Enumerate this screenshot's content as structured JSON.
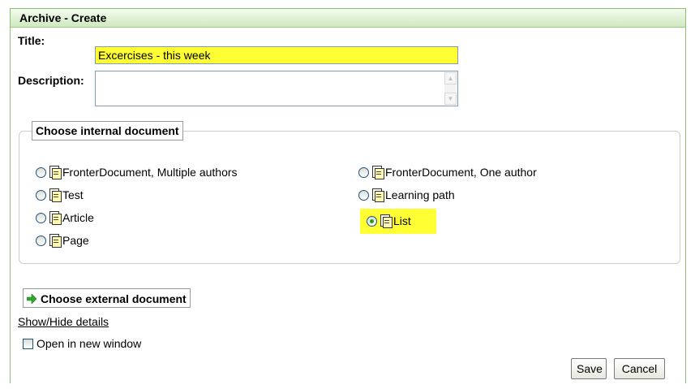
{
  "window": {
    "title": "Archive - Create"
  },
  "form": {
    "title_label": "Title:",
    "title_value": "Excercises - this week",
    "description_label": "Description:",
    "description_value": ""
  },
  "internal_group": {
    "legend": "Choose internal document",
    "options": [
      {
        "label": "FronterDocument, Multiple authors",
        "icon": "fronter-multi-icon",
        "selected": false
      },
      {
        "label": "Test",
        "icon": "test-icon",
        "selected": false
      },
      {
        "label": "Article",
        "icon": "article-icon",
        "selected": false
      },
      {
        "label": "Page",
        "icon": "page-icon",
        "selected": false
      },
      {
        "label": "FronterDocument, One author",
        "icon": "fronter-single-icon",
        "selected": false
      },
      {
        "label": "Learning path",
        "icon": "learning-path-icon",
        "selected": false
      },
      {
        "label": "List",
        "icon": "list-icon",
        "selected": true
      }
    ]
  },
  "external": {
    "label": "Choose external document",
    "icon": "green-arrow-icon"
  },
  "details_link": "Show/Hide details",
  "new_window": {
    "label": "Open in new window",
    "checked": false
  },
  "buttons": {
    "save": "Save",
    "cancel": "Cancel"
  },
  "colors": {
    "highlight": "#ffff33",
    "header_green": "#cfe9bf",
    "border_green": "#8fbf72",
    "radio_selected": "#21a121"
  }
}
